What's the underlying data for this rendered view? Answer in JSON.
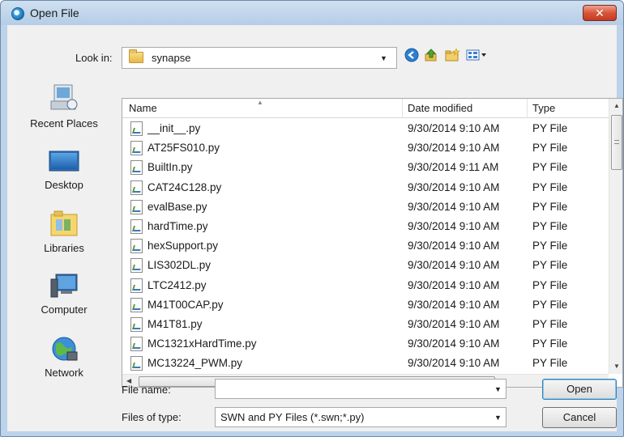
{
  "window": {
    "title": "Open File",
    "close_glyph": "✕"
  },
  "toolbar": {
    "look_in_label": "Look in:",
    "look_in_value": "synapse",
    "back_icon": "back-arrow-icon",
    "up_icon": "up-folder-icon",
    "new_folder_icon": "new-folder-icon",
    "view_icon": "view-menu-icon"
  },
  "places": [
    {
      "label": "Recent Places",
      "icon": "recent-places-icon"
    },
    {
      "label": "Desktop",
      "icon": "desktop-icon"
    },
    {
      "label": "Libraries",
      "icon": "libraries-icon"
    },
    {
      "label": "Computer",
      "icon": "computer-icon"
    },
    {
      "label": "Network",
      "icon": "network-icon"
    }
  ],
  "file_list": {
    "columns": [
      "Name",
      "Date modified",
      "Type"
    ],
    "rows": [
      {
        "name": "__init__.py",
        "date": "9/30/2014 9:10 AM",
        "type": "PY File"
      },
      {
        "name": "AT25FS010.py",
        "date": "9/30/2014 9:10 AM",
        "type": "PY File"
      },
      {
        "name": "BuiltIn.py",
        "date": "9/30/2014 9:11 AM",
        "type": "PY File"
      },
      {
        "name": "CAT24C128.py",
        "date": "9/30/2014 9:10 AM",
        "type": "PY File"
      },
      {
        "name": "evalBase.py",
        "date": "9/30/2014 9:10 AM",
        "type": "PY File"
      },
      {
        "name": "hardTime.py",
        "date": "9/30/2014 9:10 AM",
        "type": "PY File"
      },
      {
        "name": "hexSupport.py",
        "date": "9/30/2014 9:10 AM",
        "type": "PY File"
      },
      {
        "name": "LIS302DL.py",
        "date": "9/30/2014 9:10 AM",
        "type": "PY File"
      },
      {
        "name": "LTC2412.py",
        "date": "9/30/2014 9:10 AM",
        "type": "PY File"
      },
      {
        "name": "M41T00CAP.py",
        "date": "9/30/2014 9:10 AM",
        "type": "PY File"
      },
      {
        "name": "M41T81.py",
        "date": "9/30/2014 9:10 AM",
        "type": "PY File"
      },
      {
        "name": "MC1321xHardTime.py",
        "date": "9/30/2014 9:10 AM",
        "type": "PY File"
      },
      {
        "name": "MC13224_PWM.py",
        "date": "9/30/2014 9:10 AM",
        "type": "PY File"
      }
    ]
  },
  "footer": {
    "file_name_label": "File name:",
    "file_name_value": "",
    "file_type_label": "Files of type:",
    "file_type_value": "SWN and PY Files (*.swn;*.py)",
    "open_label": "Open",
    "cancel_label": "Cancel"
  }
}
